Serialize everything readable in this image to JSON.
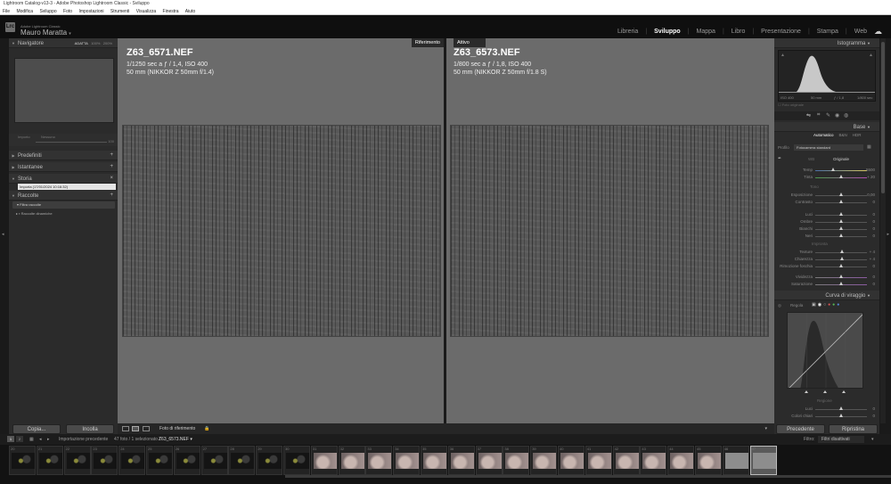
{
  "window": {
    "title": "Lightroom Catalog-v13-3 - Adobe Photoshop Lightroom Classic - Sviluppo"
  },
  "menu": [
    "File",
    "Modifica",
    "Sviluppo",
    "Foto",
    "Impostazioni",
    "Strumenti",
    "Visualizza",
    "Finestra",
    "Aiuto"
  ],
  "identity": {
    "app": "Adobe Lightroom Classic",
    "user": "Mauro Maratta",
    "arrow": "▾",
    "logo": "Lrc"
  },
  "modules": [
    {
      "label": "Libreria",
      "active": false
    },
    {
      "label": "Sviluppo",
      "active": true
    },
    {
      "label": "Mappa",
      "active": false
    },
    {
      "label": "Libro",
      "active": false
    },
    {
      "label": "Presentazione",
      "active": false
    },
    {
      "label": "Stampa",
      "active": false
    },
    {
      "label": "Web",
      "active": false
    }
  ],
  "left": {
    "navigator": {
      "title": "Navigatore",
      "zoom": [
        "ADATTA",
        "100%",
        "200%"
      ]
    },
    "preset_amount": {
      "label": "Predefiniti",
      "options": [
        "Importo",
        "Nessuno"
      ],
      "value": "100"
    },
    "panels": [
      "Predefiniti",
      "Istantanee",
      "Storia",
      "Raccolte"
    ],
    "history_item": "Importa (17/01/2024 10:16:32)",
    "collections": [
      "Filtra raccolte",
      "Raccolte dinamiche"
    ],
    "copy_button": "Copia...",
    "paste_button": "Incolla"
  },
  "compare": {
    "ref_tag": "Riferimento",
    "active_tag": "Attivo",
    "left": {
      "file": "Z63_6571.NEF",
      "exp": "1/1250 sec a ƒ / 1,4, ISO 400",
      "lens": "50 mm (NIKKOR Z 50mm f/1.4)"
    },
    "right": {
      "file": "Z63_6573.NEF",
      "exp": "1/800 sec a ƒ / 1,8, ISO 400",
      "lens": "50 mm (NIKKOR Z 50mm f/1.8 S)"
    }
  },
  "toolbar": {
    "ref_label": "Foto di riferimento"
  },
  "filmbar": {
    "pages": [
      "1",
      "2"
    ],
    "source": "Importazione precedente",
    "info": "47 foto / 1 selezionato /",
    "current": "Z63_6573.NEF",
    "arrow": "▾",
    "filter_label": "Filtro:",
    "filter_value": "Filtri disattivati"
  },
  "film_numbers": [
    "20",
    "21",
    "22",
    "23",
    "24",
    "25",
    "26",
    "27",
    "28",
    "29",
    "30",
    "31",
    "32",
    "33",
    "34",
    "35",
    "36",
    "37",
    "38",
    "39",
    "40",
    "41",
    "42",
    "43",
    "44",
    "45",
    "46",
    "47"
  ],
  "film_kinds": [
    "d",
    "d",
    "d",
    "d",
    "d",
    "d",
    "d",
    "d",
    "d",
    "d",
    "d",
    "l",
    "l",
    "l",
    "l",
    "l",
    "l",
    "l",
    "l",
    "l",
    "l",
    "l",
    "l",
    "l",
    "l",
    "l",
    "g",
    "g"
  ],
  "right": {
    "histogram_title": "Istogramma",
    "histo_info": [
      "ISO 400",
      "50 mm",
      "ƒ / 1,8",
      "1/800 sec"
    ],
    "orig_photo": "Foto originale",
    "base_title": "Base",
    "treatment": [
      "Automatico",
      "B&N",
      "HDR"
    ],
    "profile_label": "Profilo",
    "profile_value": "Fotocamera standard",
    "wb_label": "WB",
    "wb_value": "Originale",
    "tone_header": "Tono",
    "presence_header": "Impronta",
    "sliders": [
      {
        "label": "Temp",
        "value": "5500",
        "pos": 0.35
      },
      {
        "label": "Tinta",
        "value": "+ 20",
        "pos": 0.5
      },
      {
        "label": "Esposizione",
        "value": "0,00",
        "pos": 0.5
      },
      {
        "label": "Contrasto",
        "value": "0",
        "pos": 0.5
      },
      {
        "label": "Luci",
        "value": "0",
        "pos": 0.5
      },
      {
        "label": "Ombre",
        "value": "0",
        "pos": 0.5
      },
      {
        "label": "Bianchi",
        "value": "0",
        "pos": 0.5
      },
      {
        "label": "Neri",
        "value": "0",
        "pos": 0.5
      },
      {
        "label": "Texture",
        "value": "+ 4",
        "pos": 0.52
      },
      {
        "label": "Chiarezza",
        "value": "+ 4",
        "pos": 0.52
      },
      {
        "label": "Rimozione foschia",
        "value": "0",
        "pos": 0.5
      },
      {
        "label": "Vividezza",
        "value": "0",
        "pos": 0.5
      },
      {
        "label": "Saturazione",
        "value": "0",
        "pos": 0.5
      }
    ],
    "curve_title": "Curva di viraggio",
    "curve_adjust": "Regola",
    "region_label": "Regione",
    "region_items": [
      {
        "label": "Luci",
        "value": "0"
      },
      {
        "label": "Colori chiari",
        "value": "0"
      }
    ],
    "prev_button": "Precedente",
    "reset_button": "Ripristina"
  }
}
